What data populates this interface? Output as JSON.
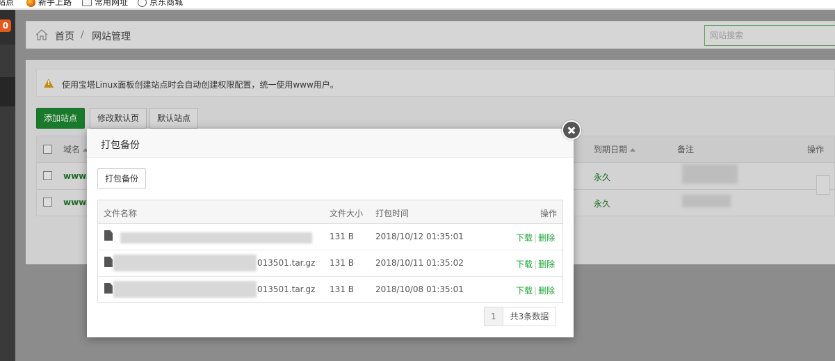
{
  "bookmarks": [
    {
      "label": "站点",
      "icon": "none"
    },
    {
      "label": "新手上路",
      "icon": "firefox-icon"
    },
    {
      "label": "常用网址",
      "icon": "folder-icon"
    },
    {
      "label": "京东商城",
      "icon": "globe-icon"
    }
  ],
  "sidebar": {
    "badge": "0"
  },
  "breadcrumb": {
    "home": "首页",
    "separator": "/",
    "current": "网站管理"
  },
  "search": {
    "placeholder": "网站搜索"
  },
  "notice": {
    "text": "使用宝塔Linux面板创建站点时会自动创建权限配置，统一使用www用户。"
  },
  "toolbar": {
    "add_site": "添加站点",
    "edit_default_page": "修改默认页",
    "default_site": "默认站点"
  },
  "site_table": {
    "headers": {
      "domain": "域名",
      "expire": "到期日期",
      "remark": "备注",
      "actions": "操作"
    },
    "rows": [
      {
        "domain": "www.i",
        "expire": "永久"
      },
      {
        "domain": "www.i",
        "expire": "永久"
      }
    ]
  },
  "modal": {
    "title": "打包备份",
    "backup_button": "打包备份",
    "headers": {
      "filename": "文件名称",
      "size": "文件大小",
      "time": "打包时间",
      "actions": "操作"
    },
    "rows": [
      {
        "filename": "",
        "size": "131 B",
        "time": "2018/10/12 01:35:01",
        "download": "下载",
        "delete": "删除"
      },
      {
        "filename": "013501.tar.gz",
        "size": "131 B",
        "time": "2018/10/11 01:35:02",
        "download": "下载",
        "delete": "删除"
      },
      {
        "filename": "013501.tar.gz",
        "size": "131 B",
        "time": "2018/10/08 01:35:01",
        "download": "下载",
        "delete": "删除"
      }
    ],
    "action_separator": "|",
    "pager": {
      "page": "1",
      "total": "共3条数据"
    }
  },
  "colors": {
    "accent_green": "#20a53a",
    "button_green": "#20a53a",
    "badge_orange": "#e55a1c"
  }
}
